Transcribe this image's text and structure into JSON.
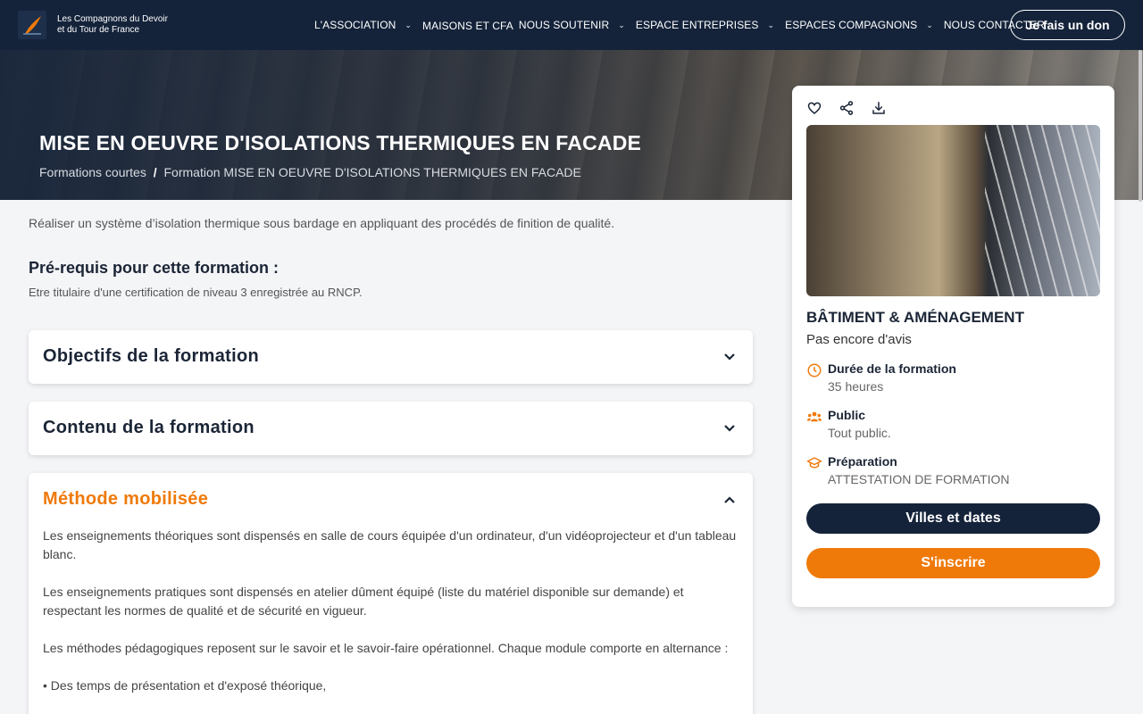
{
  "brand": {
    "name_line1": "Les Compagnons du Devoir",
    "name_line2": "et du Tour de France"
  },
  "nav": {
    "items": [
      {
        "label": "L'ASSOCIATION",
        "has_menu": true
      },
      {
        "label": "MAISONS ET CFA",
        "has_menu": false
      },
      {
        "label": "NOUS SOUTENIR",
        "has_menu": true
      },
      {
        "label": "ESPACE ENTREPRISES",
        "has_menu": true
      },
      {
        "label": "ESPACES COMPAGNONS",
        "has_menu": true
      },
      {
        "label": "NOUS CONTACTER",
        "has_menu": false
      }
    ],
    "donate_label": "Je fais un don"
  },
  "hero": {
    "title": "MISE EN OEUVRE D'ISOLATIONS THERMIQUES EN FACADE",
    "breadcrumb": [
      "Formations courtes",
      "Formation MISE EN OEUVRE D'ISOLATIONS THERMIQUES EN FACADE"
    ],
    "breadcrumb_sep": "/"
  },
  "main": {
    "intro": "Réaliser un système d’isolation thermique sous bardage en appliquant des procédés de finition de qualité.",
    "prereq_title": "Pré-requis pour cette formation :",
    "prereq_text": "Etre titulaire d'une certification de niveau 3 enregistrée au RNCP.",
    "accordions": [
      {
        "title": "Objectifs de la formation",
        "open": false
      },
      {
        "title": "Contenu de la formation",
        "open": false
      },
      {
        "title": "Méthode mobilisée",
        "open": true,
        "paragraphs": [
          "Les enseignements théoriques sont dispensés en salle de cours équipée d'un ordinateur, d'un vidéoprojecteur et d'un tableau blanc.",
          "Les enseignements pratiques sont dispensés en atelier dûment équipé (liste du matériel disponible sur demande) et respectant les normes de qualité et de sécurité en vigueur.",
          "Les méthodes pédagogiques reposent sur le savoir et le savoir-faire opérationnel. Chaque module comporte en alternance :",
          "• Des temps de présentation et d'exposé théorique,"
        ]
      }
    ]
  },
  "card": {
    "category": "BÂTIMENT & AMÉNAGEMENT",
    "reviews": "Pas encore d'avis",
    "duration_label": "Durée de la formation",
    "duration_value": "35 heures",
    "public_label": "Public",
    "public_value": "Tout public.",
    "prep_label": "Préparation",
    "prep_value": "ATTESTATION DE FORMATION",
    "dates_button": "Villes et dates",
    "subscribe_button": "S'inscrire"
  },
  "colors": {
    "navy": "#14233a",
    "orange": "#ef7a0a"
  }
}
